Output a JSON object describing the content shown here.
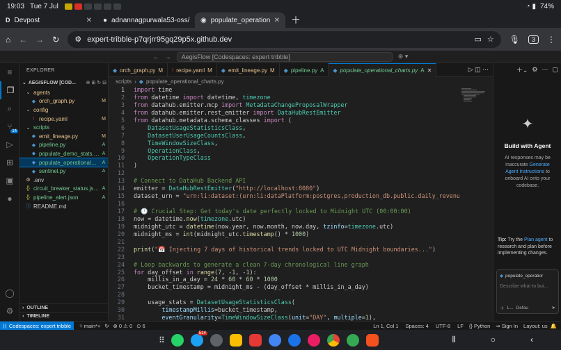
{
  "system": {
    "time": "19:03",
    "date": "Tue 7 Jul",
    "battery": "74%"
  },
  "tabs": [
    {
      "label": "Devpost",
      "icon": "D"
    },
    {
      "label": "adnannagpurwala53-oss/",
      "icon": "github-icon"
    },
    {
      "label": "populate_operational_char",
      "icon": "codespaces-icon"
    }
  ],
  "url": "expert-tribble-p7qrjrr95gq29p5x.github.dev",
  "tab_count": "3",
  "vscode": {
    "window_title": "AegisFlow [Codespaces: expert tribble]"
  },
  "explorer": {
    "title": "EXPLORER",
    "project": "AEGISFLOW [COD...",
    "items": [
      {
        "name": "agents",
        "type": "folder",
        "indent": 1,
        "status": "",
        "color": "#e2c08d"
      },
      {
        "name": "orch_graph.py",
        "type": "py",
        "indent": 2,
        "status": "M",
        "color": "#e2c08d"
      },
      {
        "name": "config",
        "type": "folder",
        "indent": 1,
        "status": "",
        "color": "#e2c08d"
      },
      {
        "name": "recipe.yaml",
        "type": "yaml",
        "indent": 2,
        "status": "M",
        "color": "#e2c08d"
      },
      {
        "name": "scripts",
        "type": "folder",
        "indent": 1,
        "status": "",
        "color": "#73c991"
      },
      {
        "name": "emit_lineage.py",
        "type": "py",
        "indent": 2,
        "status": "M",
        "color": "#e2c08d"
      },
      {
        "name": "pipeline.py",
        "type": "py",
        "indent": 2,
        "status": "A",
        "color": "#73c991"
      },
      {
        "name": "populate_demo_stats.py",
        "type": "py",
        "indent": 2,
        "status": "A",
        "color": "#73c991"
      },
      {
        "name": "populate_operational_cha...",
        "type": "py",
        "indent": 2,
        "status": "A",
        "color": "#73c991",
        "selected": true
      },
      {
        "name": "sentinel.py",
        "type": "py",
        "indent": 2,
        "status": "A",
        "color": "#73c991"
      },
      {
        "name": ".env",
        "type": "env",
        "indent": 1,
        "status": "",
        "color": "#cccccc"
      },
      {
        "name": "circuit_breaker_status.json",
        "type": "json",
        "indent": 1,
        "status": "A",
        "color": "#73c991"
      },
      {
        "name": "pipeline_alert.json",
        "type": "json",
        "indent": 1,
        "status": "A",
        "color": "#73c991"
      },
      {
        "name": "README.md",
        "type": "md",
        "indent": 1,
        "status": "",
        "color": "#cccccc"
      }
    ],
    "outline": "OUTLINE",
    "timeline": "TIMELINE"
  },
  "editor_tabs": [
    {
      "label": "orch_graph.py",
      "status": "M",
      "kind": "m"
    },
    {
      "label": "recipe.yaml",
      "status": "M",
      "kind": "m"
    },
    {
      "label": "emit_lineage.py",
      "status": "M",
      "kind": "m"
    },
    {
      "label": "pipeline.py",
      "status": "A",
      "kind": "a"
    },
    {
      "label": "populate_operational_charts.py",
      "status": "A",
      "kind": "a",
      "active": true
    }
  ],
  "breadcrumb": [
    "scripts",
    "populate_operational_charts.py"
  ],
  "code_lines": [
    "import time",
    "from datetime import datetime, timezone",
    "from datahub.emitter.mcp import MetadataChangeProposalWrapper",
    "from datahub.emitter.rest_emitter import DataHubRestEmitter",
    "from datahub.metadata.schema_classes import (",
    "    DatasetUsageStatisticsClass,",
    "    DatasetUserUsageCountsClass,",
    "    TimeWindowSizeClass,",
    "    OperationClass,",
    "    OperationTypeClass",
    ")",
    "",
    "# Connect to DataHub Backend API",
    "emitter = DataHubRestEmitter(\"http://localhost:8080\")",
    "dataset_urn = \"urn:li:dataset:(urn:li:dataPlatform:postgres,production_db.public.daily_revenue,PROD)\"",
    "",
    "# 🕛 Crucial Step: Get today's date perfectly locked to Midnight UTC (00:00:00)",
    "now = datetime.now(timezone.utc)",
    "midnight_utc = datetime(now.year, now.month, now.day, tzinfo=timezone.utc)",
    "midnight_ms = int(midnight_utc.timestamp() * 1000)",
    "",
    "print(\"📅 Injecting 7 days of historical trends locked to UTC Midnight boundaries...\")",
    "",
    "# Loop backwards to generate a clean 7-day chronological line graph",
    "for day_offset in range(7, -1, -1):",
    "    millis_in_a_day = 24 * 60 * 60 * 1000",
    "    bucket_timestamp = midnight_ms - (day_offset * millis_in_a_day)",
    "",
    "    usage_stats = DatasetUsageStatisticsClass(",
    "        timestampMillis=bucket_timestamp,",
    "        eventGranularity=TimeWindowSizeClass(unit=\"DAY\", multiple=1),"
  ],
  "chat": {
    "title": "Build with Agent",
    "description": "AI responses may be inaccurate",
    "link": "Generate Agent Instructions",
    "after_link": "to onboard AI onto your codebase.",
    "tip_label": "Tip:",
    "tip_text": "Try the",
    "tip_link": "Plan agent",
    "tip_rest": "to research and plan before implementing changes.",
    "file_chip": "populate_operatior",
    "placeholder": "Describe what to bui...",
    "mode": "L...",
    "model": "Defau"
  },
  "statusbar": {
    "codespace": "Codespaces: expert tribble",
    "branch": "main*+",
    "errors": "0",
    "warnings": "0",
    "ports": "6",
    "position": "Ln 1, Col 1",
    "spaces": "Spaces: 4",
    "encoding": "UTF-8",
    "eol": "LF",
    "language": "Python",
    "signin": "Sign In",
    "layout": "Layout: us"
  },
  "colors": {
    "accent": "#0078d4",
    "modified": "#e2c08d",
    "added": "#73c991"
  }
}
